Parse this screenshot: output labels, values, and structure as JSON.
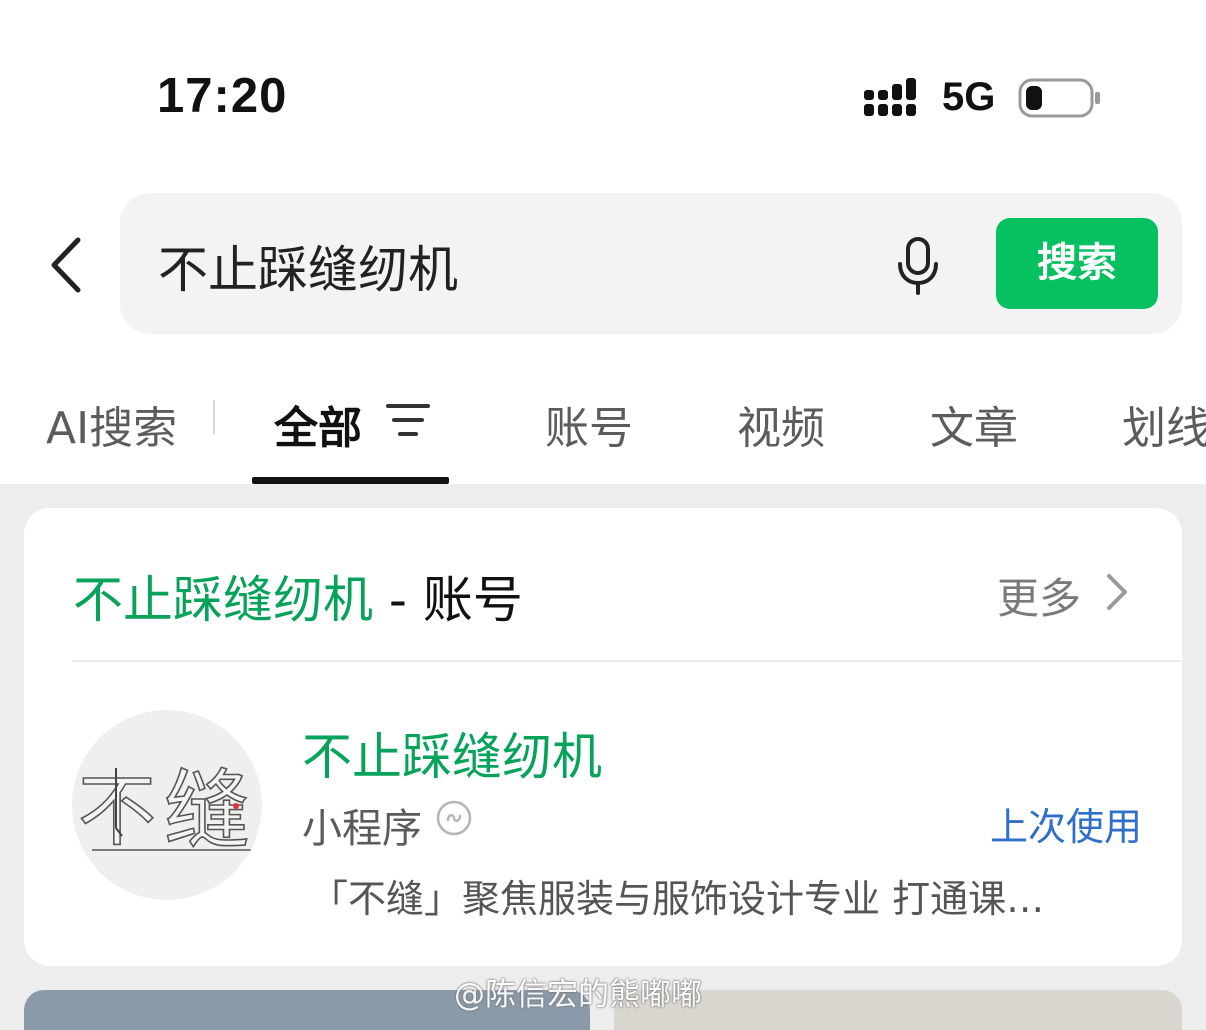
{
  "status_bar": {
    "time": "17:20",
    "network": "5G"
  },
  "search": {
    "query": "不止踩缝纫机",
    "button_label": "搜索"
  },
  "tabs": [
    {
      "label": "AI搜索"
    },
    {
      "label": "全部"
    },
    {
      "label": "账号"
    },
    {
      "label": "视频"
    },
    {
      "label": "文章"
    },
    {
      "label": "划线"
    }
  ],
  "account_section": {
    "title_highlight": "不止踩缝纫机",
    "title_suffix": " - 账号",
    "more_label": "更多",
    "result": {
      "name": "不止踩缝纫机",
      "type": "小程序",
      "badge": "上次使用",
      "description": "「不缝」聚焦服装与服饰设计专业 打通课…",
      "avatar_text": "不缝"
    }
  },
  "watermark": "@陈信宏的熊嘟嘟",
  "colors": {
    "brand_green": "#07c160",
    "highlight_green": "#07a35a",
    "link_blue": "#2f6fc9"
  }
}
